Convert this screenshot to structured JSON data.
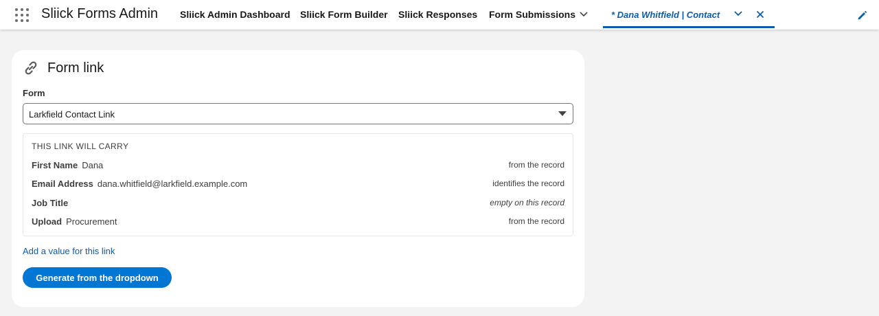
{
  "app": {
    "name": "Sliick Forms Admin"
  },
  "nav": {
    "items": [
      {
        "label": "Sliick Admin Dashboard"
      },
      {
        "label": "Sliick Form Builder"
      },
      {
        "label": "Sliick Responses"
      },
      {
        "label": "Form Submissions"
      }
    ],
    "active_tab": {
      "label": "* Dana Whitfield | Contact"
    }
  },
  "card": {
    "title": "Form link",
    "form_field": {
      "label": "Form",
      "selected": "Larkfield Contact Link"
    },
    "carry": {
      "heading": "THIS LINK WILL CARRY",
      "rows": [
        {
          "label": "First Name",
          "value": "Dana",
          "note": "from the record"
        },
        {
          "label": "Email Address",
          "value": "dana.whitfield@larkfield.example.com",
          "note": "identifies the record"
        },
        {
          "label": "Job Title",
          "value": "",
          "note": "empty on this record"
        },
        {
          "label": "Upload",
          "value": "Procurement",
          "note": "from the record"
        }
      ]
    },
    "add_value_link": "Add a value for this link",
    "generate_button": "Generate from the dropdown"
  },
  "colors": {
    "brand": "#0176d3",
    "active_tab": "#0b5cab",
    "background": "#f3f3f3"
  },
  "icons": [
    "app-launcher-icon",
    "chevron-down-icon",
    "close-icon",
    "edit-pencil-icon",
    "link-icon",
    "caret-down-icon"
  ]
}
